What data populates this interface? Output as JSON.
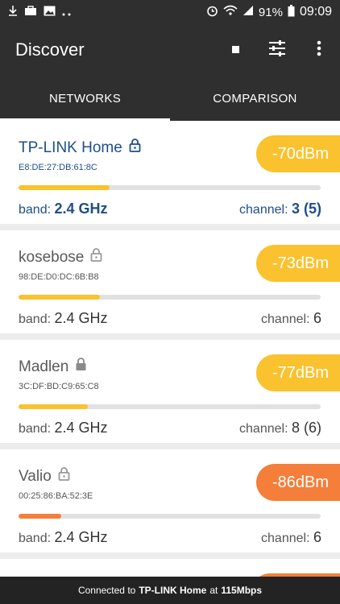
{
  "status_bar": {
    "battery": "91%",
    "time": "09:09",
    "left_icons": [
      "download-icon",
      "toolbox-icon",
      "image-icon",
      "more-dots-icon"
    ],
    "right_icons": [
      "alarm-icon",
      "wifi-icon",
      "signal-icon",
      "battery-icon"
    ]
  },
  "app_bar": {
    "title": "Discover",
    "actions": [
      "stop-icon",
      "filter-icon",
      "overflow-menu-icon"
    ]
  },
  "tabs": [
    {
      "label": "NETWORKS",
      "active": true
    },
    {
      "label": "COMPARISON",
      "active": false
    }
  ],
  "networks": [
    {
      "name": "TP-LINK Home",
      "mac": "E8:DE:27:DB:61:8C",
      "signal": "-70dBm",
      "signal_strength": 0.3,
      "band_label": "band:",
      "band": "2.4 GHz",
      "channel_label": "channel:",
      "channel": "3 (5)",
      "connected": true,
      "color": "#f9c22e"
    },
    {
      "name": "kosebose",
      "mac": "98:DE:D0:DC:6B:B8",
      "signal": "-73dBm",
      "signal_strength": 0.27,
      "band_label": "band:",
      "band": "2.4 GHz",
      "channel_label": "channel:",
      "channel": "6",
      "connected": false,
      "color": "#f9c22e"
    },
    {
      "name": "Madlen",
      "mac": "3C:DF:BD:C9:65:C8",
      "signal": "-77dBm",
      "signal_strength": 0.23,
      "band_label": "band:",
      "band": "2.4 GHz",
      "channel_label": "channel:",
      "channel": "8 (6)",
      "connected": false,
      "color": "#f9c22e"
    },
    {
      "name": "Valio",
      "mac": "00:25:86:BA:52:3E",
      "signal": "-86dBm",
      "signal_strength": 0.14,
      "band_label": "band:",
      "band": "2.4 GHz",
      "channel_label": "channel:",
      "channel": "6",
      "connected": false,
      "color": "#f47e3a"
    }
  ],
  "footer": {
    "prefix": "Connected to",
    "network": "TP-LINK Home",
    "middle": "at",
    "speed": "115Mbps"
  }
}
